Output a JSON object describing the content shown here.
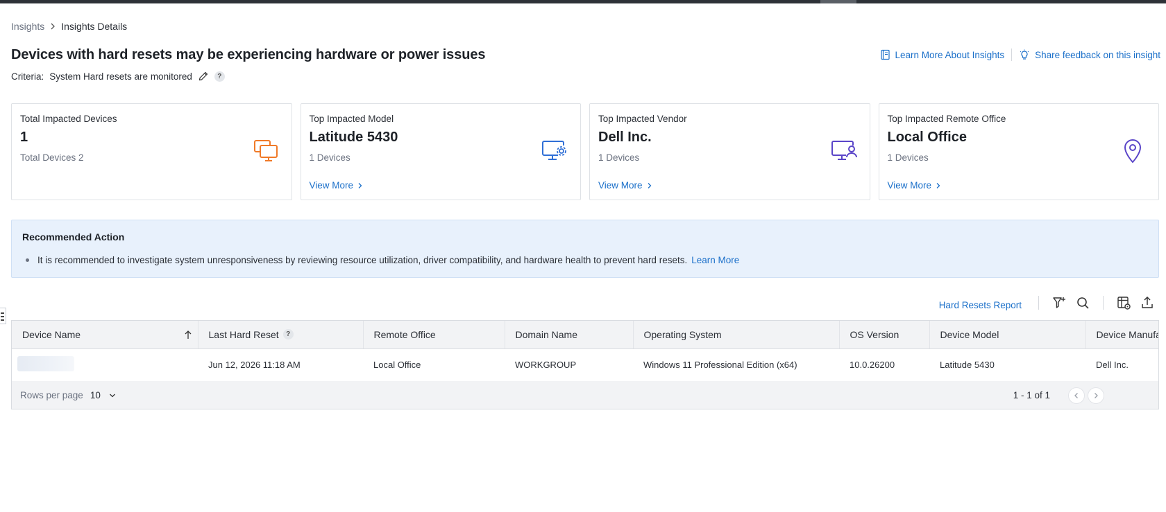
{
  "breadcrumb": {
    "root": "Insights",
    "current": "Insights Details"
  },
  "title": "Devices with hard resets may be experiencing hardware or power issues",
  "criteria": {
    "label": "Criteria:",
    "value": "System Hard resets are monitored",
    "help": "?"
  },
  "top_links": {
    "learn_more": "Learn More About Insights",
    "feedback": "Share feedback on this insight"
  },
  "cards": [
    {
      "label": "Total Impacted Devices",
      "value": "1",
      "sub": "Total Devices 2",
      "link": "",
      "icon": "multi-monitor-icon",
      "icon_color": "#f07a28"
    },
    {
      "label": "Top Impacted Model",
      "value": "Latitude 5430",
      "sub": "1 Devices",
      "link": "View More",
      "icon": "monitor-gear-icon",
      "icon_color": "#2f6fd6"
    },
    {
      "label": "Top Impacted Vendor",
      "value": "Dell Inc.",
      "sub": "1 Devices",
      "link": "View More",
      "icon": "monitor-user-icon",
      "icon_color": "#5a45c8"
    },
    {
      "label": "Top Impacted Remote Office",
      "value": "Local Office",
      "sub": "1 Devices",
      "link": "View More",
      "icon": "location-pin-icon",
      "icon_color": "#5a45c8"
    }
  ],
  "recommendation": {
    "title": "Recommended Action",
    "text": "It is recommended to investigate system unresponsiveness by reviewing resource utilization, driver compatibility, and hardware health to prevent hard resets.",
    "link": "Learn More"
  },
  "toolbar": {
    "report_link": "Hard Resets Report"
  },
  "table": {
    "columns": [
      "Device Name",
      "Last Hard Reset",
      "Remote Office",
      "Domain Name",
      "Operating System",
      "OS Version",
      "Device Model",
      "Device Manufa"
    ],
    "last_reset_help": "?",
    "rows": [
      {
        "last_hard_reset": "Jun 12, 2026 11:18 AM",
        "remote_office": "Local Office",
        "domain": "WORKGROUP",
        "os": "Windows 11 Professional Edition (x64)",
        "os_version": "10.0.26200",
        "model": "Latitude 5430",
        "manufacturer": "Dell Inc."
      }
    ]
  },
  "pager": {
    "rows_label": "Rows per page",
    "rows_value": "10",
    "range": "1 - 1 of 1"
  }
}
